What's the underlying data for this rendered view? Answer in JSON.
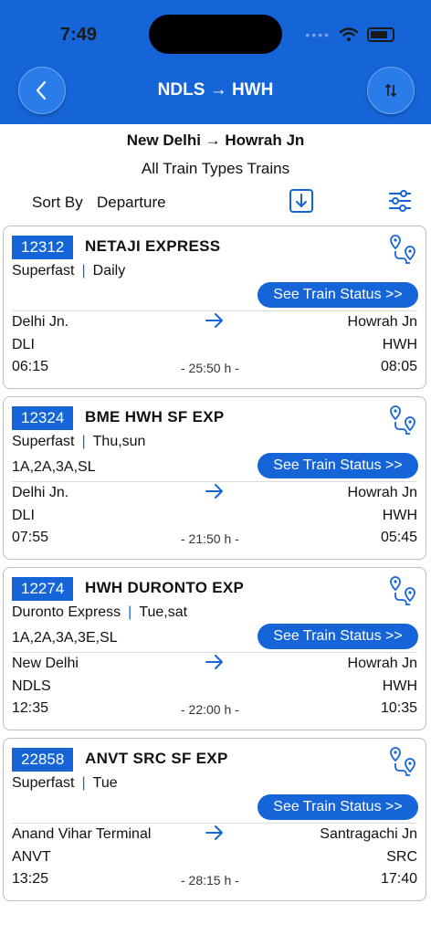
{
  "status_bar": {
    "time": "7:49"
  },
  "nav": {
    "title": "NDLS → HWH"
  },
  "route_title": "New Delhi → Howrah Jn",
  "train_types_title": "All Train Types Trains",
  "sort": {
    "label": "Sort By",
    "value": "Departure"
  },
  "trains": [
    {
      "number": "12312",
      "name": "NETAJI EXPRESS",
      "type": "Superfast",
      "days": "Daily",
      "classes": "",
      "status_label": "See Train Status >>",
      "from_name": "Delhi Jn.",
      "from_code": "DLI",
      "to_name": "Howrah Jn",
      "to_code": "HWH",
      "dep": "06:15",
      "arr": "08:05",
      "duration": "- 25:50 h -"
    },
    {
      "number": "12324",
      "name": "BME HWH SF EXP",
      "type": "Superfast",
      "days": "Thu,sun",
      "classes": "1A,2A,3A,SL",
      "status_label": "See Train Status >>",
      "from_name": "Delhi Jn.",
      "from_code": "DLI",
      "to_name": "Howrah Jn",
      "to_code": "HWH",
      "dep": "07:55",
      "arr": "05:45",
      "duration": "- 21:50 h -"
    },
    {
      "number": "12274",
      "name": "HWH DURONTO EXP",
      "type": "Duronto Express",
      "days": "Tue,sat",
      "classes": "1A,2A,3A,3E,SL",
      "status_label": "See Train Status >>",
      "from_name": "New Delhi",
      "from_code": "NDLS",
      "to_name": "Howrah Jn",
      "to_code": "HWH",
      "dep": "12:35",
      "arr": "10:35",
      "duration": "- 22:00 h -"
    },
    {
      "number": "22858",
      "name": "ANVT SRC SF EXP",
      "type": "Superfast",
      "days": "Tue",
      "classes": "",
      "status_label": "See Train Status >>",
      "from_name": "Anand Vihar Terminal",
      "from_code": "ANVT",
      "to_name": "Santragachi Jn",
      "to_code": "SRC",
      "dep": "13:25",
      "arr": "17:40",
      "duration": "- 28:15 h -"
    }
  ],
  "colors": {
    "primary": "#1565d8",
    "background": "#ffffff",
    "border": "#bdbdbd"
  },
  "icons": {
    "back": "chevron-left-icon",
    "swap": "swap-vertical-icon",
    "sort": "arrow-down-icon",
    "filter": "sliders-icon",
    "route": "route-map-icon",
    "direction": "arrow-right-icon"
  }
}
